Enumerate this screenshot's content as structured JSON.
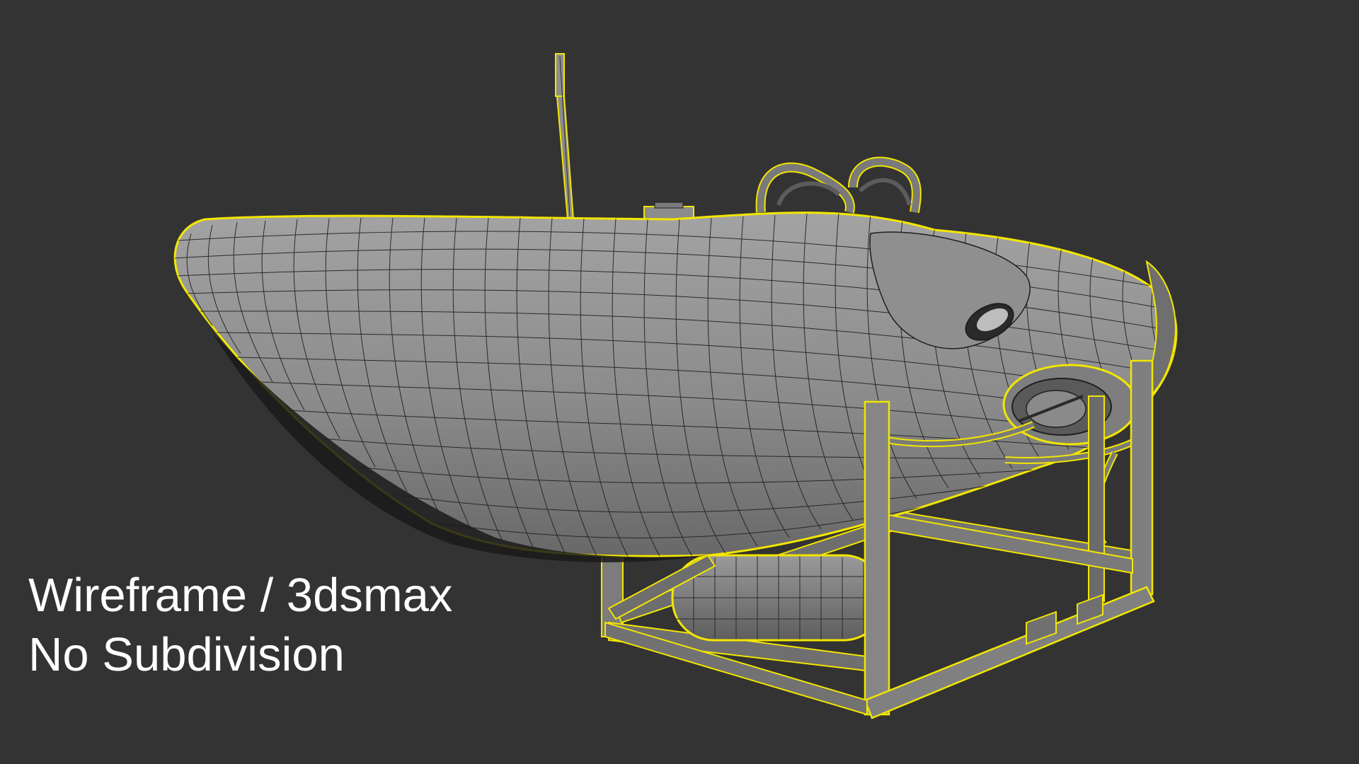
{
  "caption": {
    "line1": "Wireframe / 3dsmax",
    "line2": "No Subdivision"
  },
  "colors": {
    "background": "#333333",
    "selection_outline": "#f2e600",
    "wire": "#1e1e1e",
    "hull_shade": "#8a8a8a",
    "frame_shade": "#7e7e7e"
  }
}
